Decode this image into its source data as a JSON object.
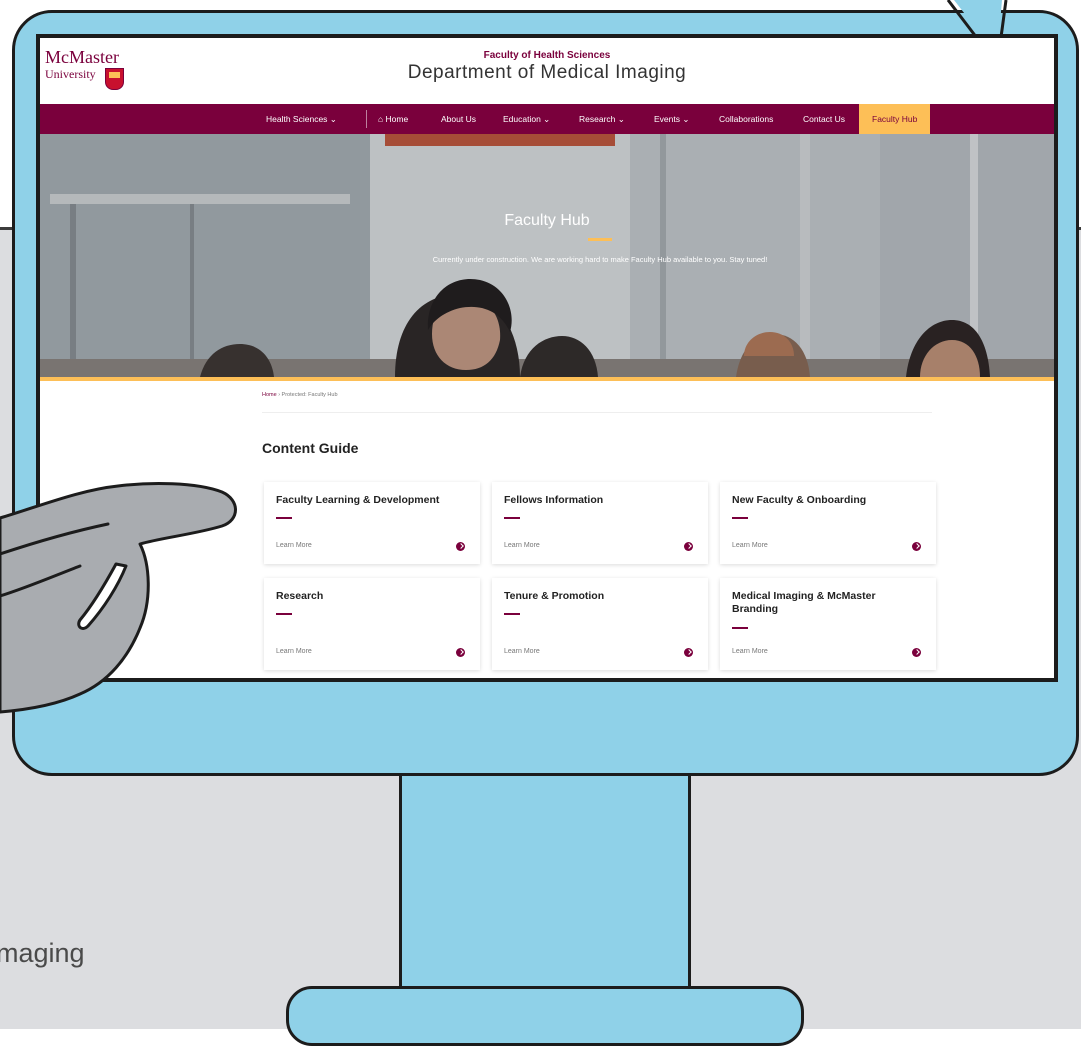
{
  "site": {
    "logo_name": "McMaster",
    "logo_sub": "University",
    "super_title": "Faculty of Health Sciences",
    "title": "Department of Medical Imaging"
  },
  "nav": {
    "items": [
      {
        "label": "Health Sciences ⌄",
        "icon": "chevron-down-icon"
      },
      {
        "label": "⌂  Home",
        "icon": "home-icon"
      },
      {
        "label": "About Us"
      },
      {
        "label": "Education ⌄",
        "icon": "chevron-down-icon"
      },
      {
        "label": "Research ⌄",
        "icon": "chevron-down-icon"
      },
      {
        "label": "Events ⌄",
        "icon": "chevron-down-icon"
      },
      {
        "label": "Collaborations"
      },
      {
        "label": "Contact Us"
      },
      {
        "label": "Faculty Hub",
        "active": true
      }
    ]
  },
  "hero": {
    "title": "Faculty Hub",
    "text": "Currently under construction. We are working hard to make Faculty Hub available to you. Stay tuned!"
  },
  "breadcrumb": {
    "home": "Home",
    "rest": " › Protected: Faculty Hub"
  },
  "content": {
    "guide_title": "Content Guide",
    "cards": [
      {
        "title": "Faculty Learning & Development",
        "link": "Learn More"
      },
      {
        "title": "Fellows Information",
        "link": "Learn More"
      },
      {
        "title": "New Faculty & Onboarding",
        "link": "Learn More"
      },
      {
        "title": "Research",
        "link": "Learn More"
      },
      {
        "title": "Tenure & Promotion",
        "link": "Learn More"
      },
      {
        "title": "Medical Imaging & McMaster Branding",
        "link": "Learn More"
      }
    ]
  },
  "background": {
    "caption": "maging"
  },
  "colors": {
    "maroon": "#7a003c",
    "gold": "#fdbf57",
    "monitor": "#8fd1e8",
    "backdrop": "#dcdde0"
  }
}
